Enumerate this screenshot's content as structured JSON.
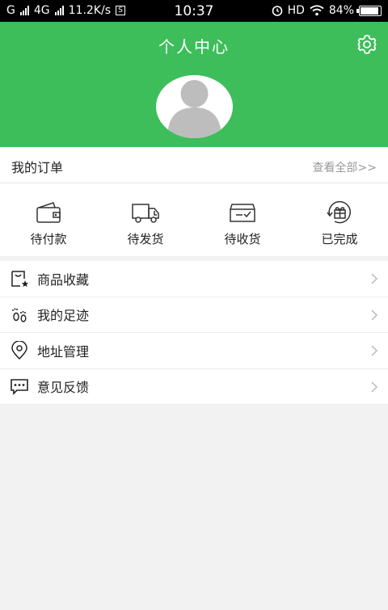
{
  "status_bar": {
    "carrier1": "G",
    "carrier2": "4G",
    "speed": "11.2K/s",
    "speed_badge": "S",
    "time": "10:37",
    "hd": "HD",
    "battery": "84%"
  },
  "header": {
    "title": "个人中心"
  },
  "orders": {
    "title": "我的订单",
    "view_all": "查看全部>>",
    "items": [
      {
        "label": "待付款",
        "icon": "wallet-icon"
      },
      {
        "label": "待发货",
        "icon": "truck-icon"
      },
      {
        "label": "待收货",
        "icon": "inbox-check-icon"
      },
      {
        "label": "已完成",
        "icon": "gift-refresh-icon"
      }
    ]
  },
  "menu": {
    "items": [
      {
        "label": "商品收藏",
        "icon": "bag-star-icon"
      },
      {
        "label": "我的足迹",
        "icon": "footprints-icon"
      },
      {
        "label": "地址管理",
        "icon": "location-pin-icon"
      },
      {
        "label": "意见反馈",
        "icon": "chat-bubble-icon"
      }
    ]
  },
  "colors": {
    "brand_green": "#3dbe5a",
    "background": "#f2f2f2",
    "muted_text": "#999999"
  }
}
